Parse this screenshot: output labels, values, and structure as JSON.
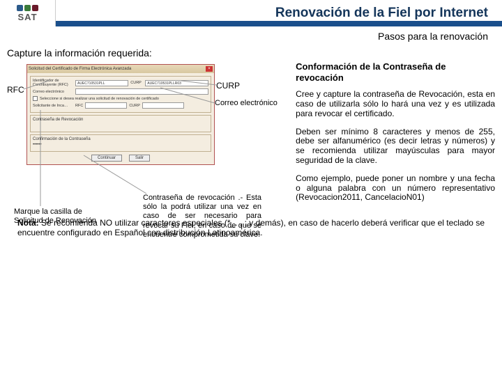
{
  "header": {
    "logo_text": "SAT",
    "title": "Renovación de la Fiel por Internet"
  },
  "subtitle": "Pasos para la renovación",
  "left": {
    "section_head": "Capture la información requerida:",
    "window_title": "Solicitud del Certificado de Firma Electrónica Avanzada",
    "field_rfc_label": "Identificador de Contribuyente (RFC)",
    "field_rfc_value": "AUEC710531PLL",
    "field_curp_label": "CURP",
    "field_curp_value": "AUEC710531PLLR03",
    "field_email_label": "Correo electrónico",
    "chk_renov": "Seleccione si desea realizar una solicitud de renovación de certificado",
    "sol_lab": "Solicitante de Inca…",
    "rfc_lab2": "RFC",
    "curp_lab2": "CURP",
    "fs2_title": "Contraseña de Revocación",
    "fs3_title": "Confirmación de la Contraseña",
    "btn_continue": "Continuar",
    "btn_exit": "Salir"
  },
  "callouts": {
    "rfc": "RFC",
    "curp": "CURP",
    "correo": "Correo electrónico",
    "marque": "Marque la casilla de Solicitud de Renovación",
    "revoc": "Contraseña de revocación .- Esta sólo la podrá utilizar una vez en caso de ser necesario para revocar su Fiel, en caso de que se encuentre comprometida su clave."
  },
  "right": {
    "head": "Conformación de la Contraseña de revocación",
    "p1": "Cree y capture la contraseña de Revocación, esta en caso de utilizarla sólo lo hará una vez y es utilizada para revocar el certificado.",
    "p2": "Deben ser mínimo 8 caracteres y menos de 255, debe ser alfanumérico (es decir letras y números) y se recomienda utilizar mayúsculas para mayor seguridad de la clave.",
    "p3": "Como ejemplo, puede poner un nombre y una fecha o alguna palabra con un número representativo (Revocacion2011, CancelacioN01)"
  },
  "nota_label": "Nota:",
  "nota": " Se recomienda NO utilizar caracteres especiales (*_. , ; y demás), en caso de hacerlo deberá verificar que el teclado se encuentre configurado en Español con distribución Latinoamérica."
}
